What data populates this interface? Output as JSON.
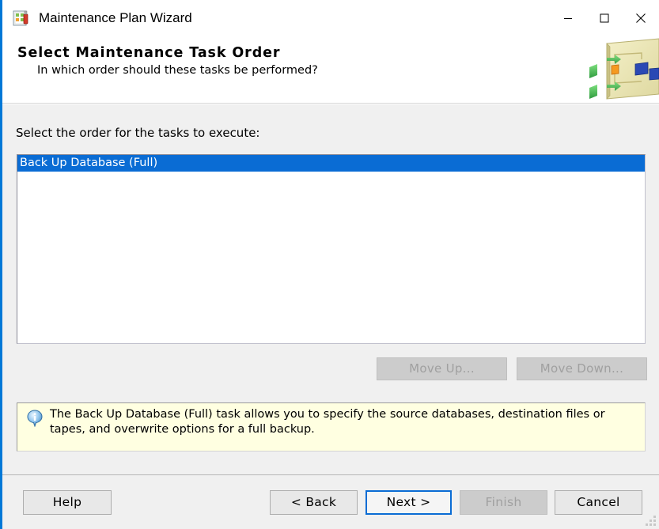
{
  "window": {
    "title": "Maintenance Plan Wizard",
    "icon": "maintenance-plan-icon",
    "controls": {
      "minimize": "minimize-icon",
      "maximize": "maximize-icon",
      "close": "close-icon"
    }
  },
  "header": {
    "title": "Select Maintenance Task Order",
    "subtitle": "In which order should these tasks be performed?",
    "art": "workflow-plan-graphic"
  },
  "main": {
    "instruction": "Select the order for the tasks to execute:",
    "tasks": [
      {
        "label": "Back Up Database (Full)",
        "selected": true
      }
    ],
    "move_up_label": "Move Up...",
    "move_down_label": "Move Down...",
    "move_up_enabled": false,
    "move_down_enabled": false
  },
  "info": {
    "icon": "info-icon",
    "text": "The Back Up Database (Full) task allows you to specify the source databases, destination files or tapes, and overwrite options for a full backup."
  },
  "footer": {
    "help_label": "Help",
    "back_label": "< Back",
    "next_label": "Next >",
    "finish_label": "Finish",
    "cancel_label": "Cancel",
    "finish_enabled": false,
    "default_button": "next"
  },
  "colors": {
    "window_border": "#0078d7",
    "selection": "#0a6cd4",
    "info_background": "#ffffe1",
    "dialog_background": "#f0f0f0",
    "disabled_text": "#a0a0a0"
  }
}
